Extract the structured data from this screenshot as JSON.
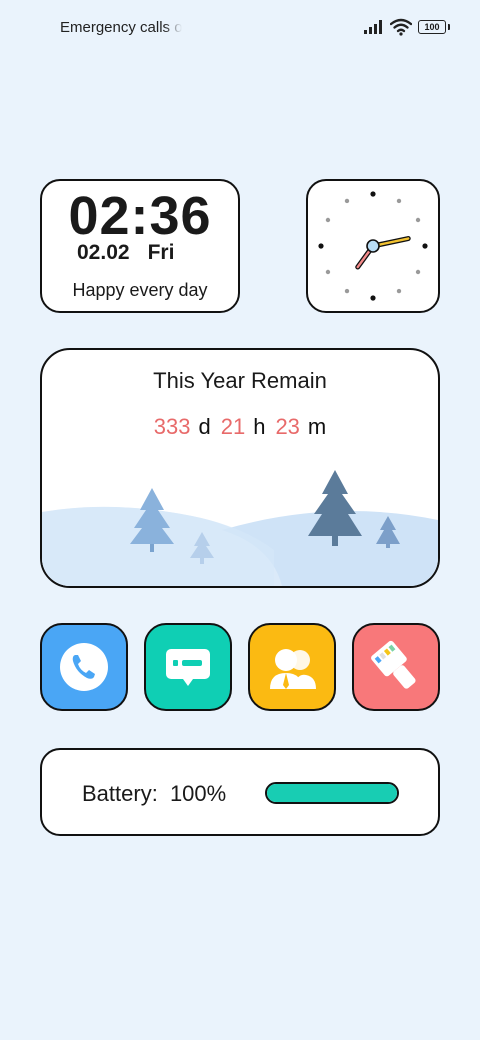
{
  "status_bar": {
    "carrier_text": "Emergency calls only",
    "battery_level": "100"
  },
  "time_widget": {
    "time": "02:36",
    "date": "02.02",
    "weekday": "Fri",
    "tagline": "Happy every day"
  },
  "analog_clock": {
    "hour": 2,
    "minute": 36
  },
  "countdown_widget": {
    "title": "This Year Remain",
    "days": "333",
    "days_unit": "d",
    "hours": "21",
    "hours_unit": "h",
    "minutes": "23",
    "minutes_unit": "m"
  },
  "apps": [
    {
      "icon": "phone-icon",
      "color": "#4aa6f5"
    },
    {
      "icon": "message-icon",
      "color": "#0fcfb4"
    },
    {
      "icon": "contacts-icon",
      "color": "#fbba12"
    },
    {
      "icon": "theme-brush-icon",
      "color": "#f8787a"
    }
  ],
  "battery_widget": {
    "label": "Battery:",
    "value": "100%",
    "fraction": 1.0,
    "fill_color": "#18cdb3"
  }
}
